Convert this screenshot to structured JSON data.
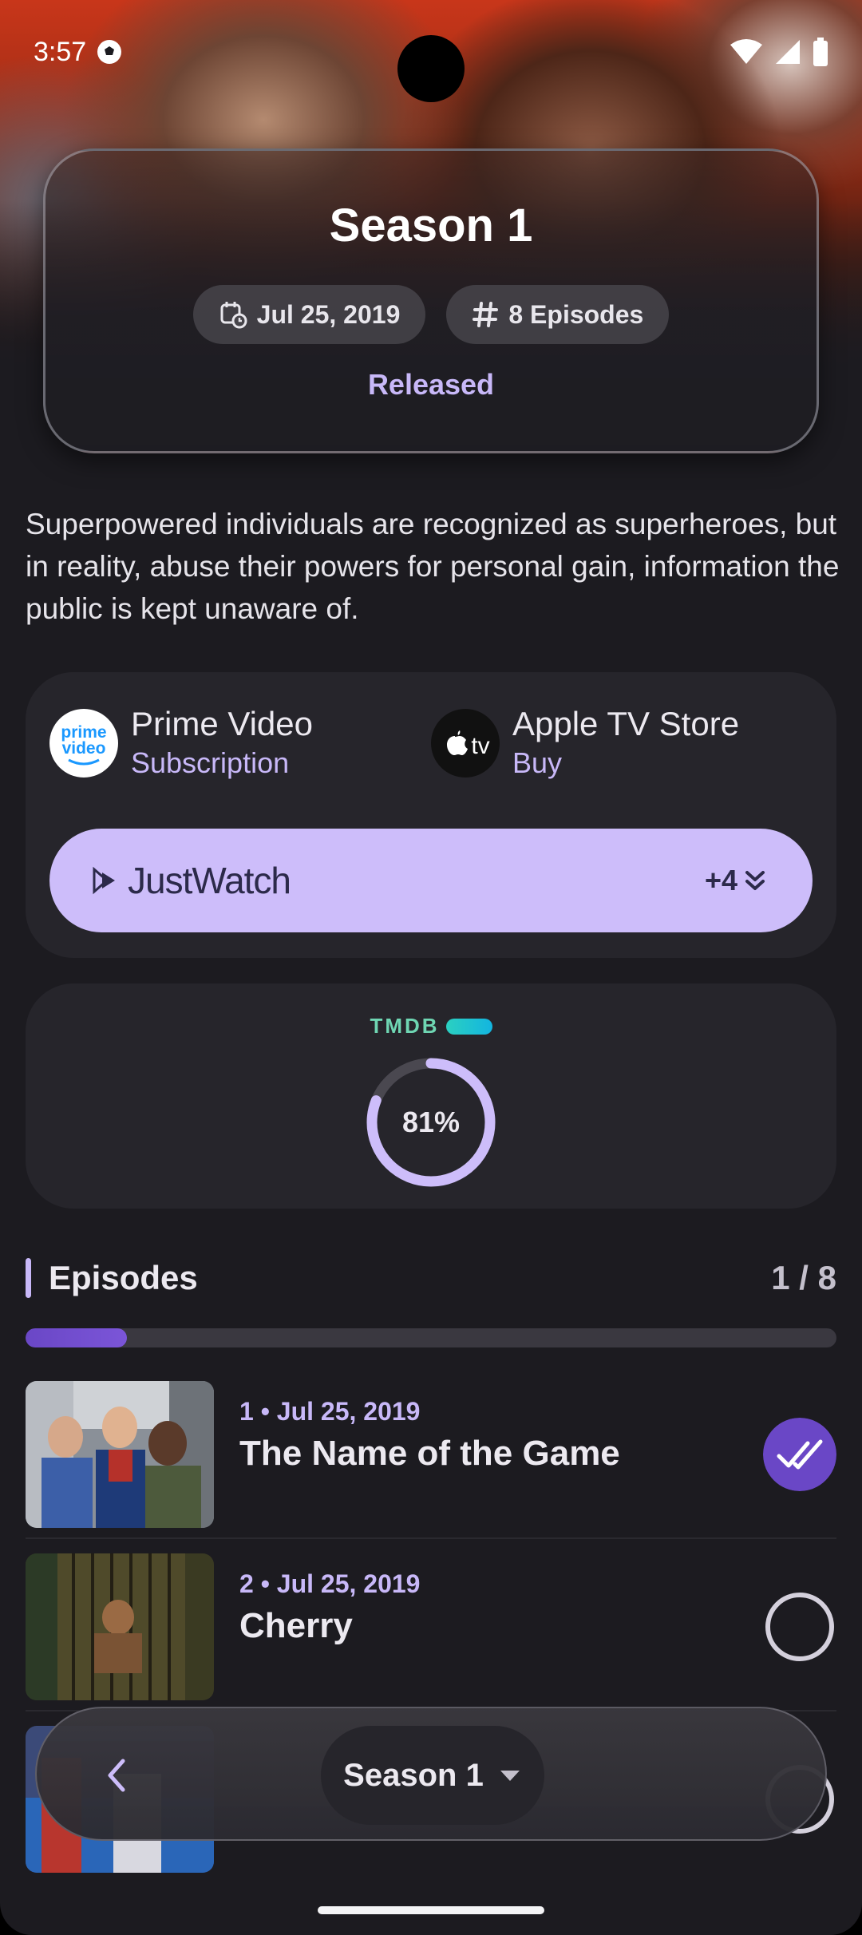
{
  "status_bar": {
    "time": "3:57"
  },
  "season": {
    "title": "Season 1",
    "air_date": "Jul 25, 2019",
    "episode_count": "8 Episodes",
    "status": "Released"
  },
  "overview": "Superpowered individuals are recognized as superheroes, but in reality, abuse their powers for personal gain, information the public is kept unaware of.",
  "providers": {
    "items": [
      {
        "name": "Prime Video",
        "type": "Subscription",
        "logo": "prime-video-logo"
      },
      {
        "name": "Apple TV Store",
        "type": "Buy",
        "logo": "apple-tv-logo"
      }
    ],
    "justwatch": {
      "label": "JustWatch",
      "more": "+4"
    }
  },
  "rating": {
    "source": "TMDB",
    "value": 81,
    "label": "81%"
  },
  "episodes": {
    "title": "Episodes",
    "count": "1 / 8",
    "watched_fraction": 0.125,
    "items": [
      {
        "meta": "1 • Jul 25, 2019",
        "name": "The Name of the Game",
        "watched": true
      },
      {
        "meta": "2 • Jul 25, 2019",
        "name": "Cherry",
        "watched": false
      }
    ]
  },
  "bottom_bar": {
    "season_select": "Season 1"
  },
  "colors": {
    "accent": "#c8b8f8",
    "check_fill": "#6a47c6",
    "background": "#1c1b20",
    "card": "#26252b"
  }
}
